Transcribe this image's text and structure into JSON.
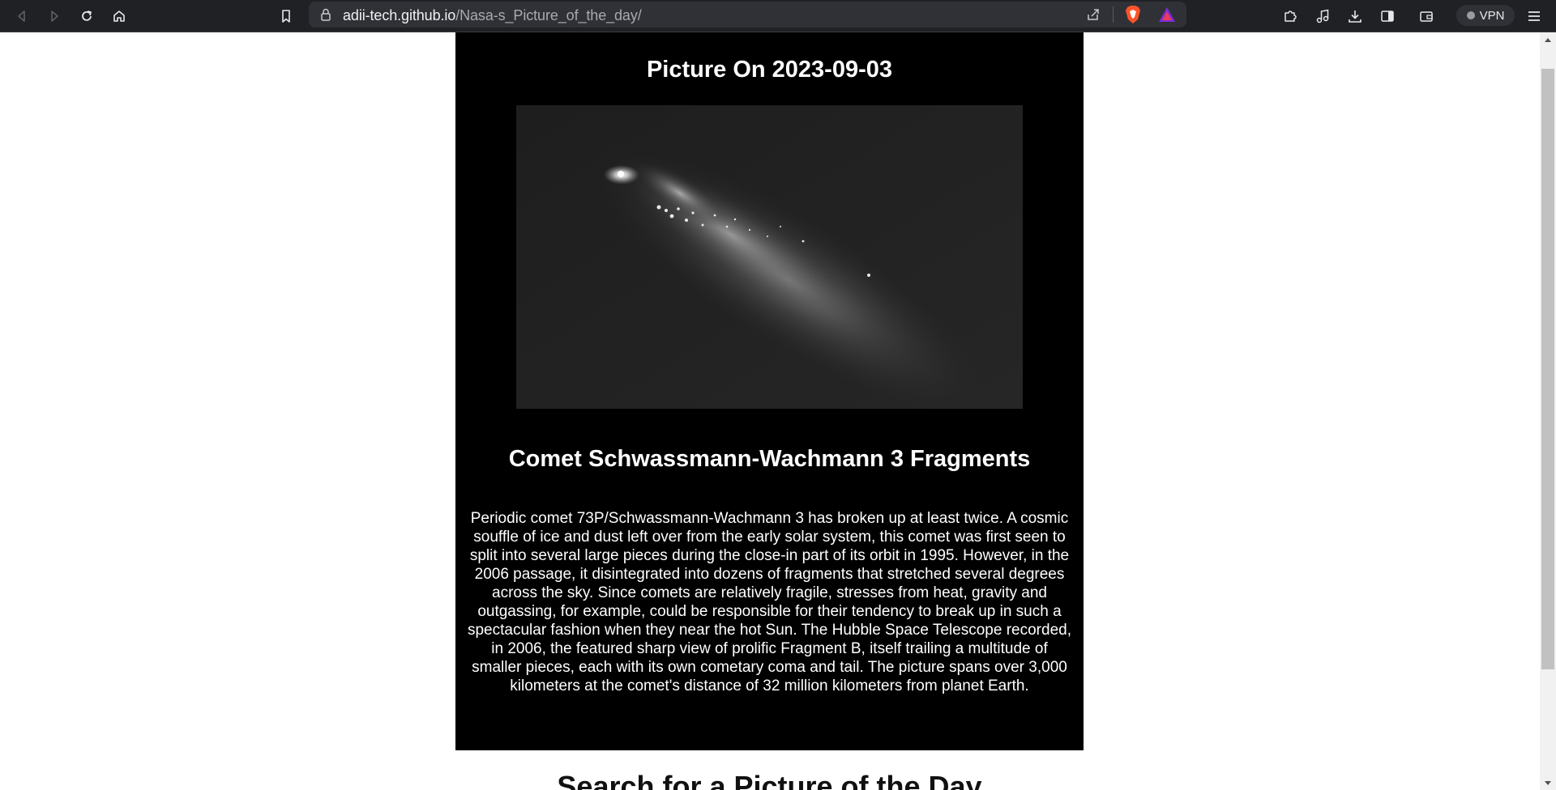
{
  "browser": {
    "url_host": "adii-tech.github.io",
    "url_path": "/Nasa-s_Picture_of_the_day/",
    "vpn_label": "VPN",
    "icons": [
      "back-icon",
      "forward-icon",
      "reload-icon",
      "home-icon",
      "bookmark-icon",
      "lock-icon",
      "share-icon",
      "brave-shields-icon",
      "brave-rewards-icon",
      "extensions-icon",
      "media-icon",
      "downloads-icon",
      "sidebar-icon",
      "wallet-icon",
      "menu-icon"
    ],
    "brave_color": "#fb542b"
  },
  "apod": {
    "date_heading": "Picture On 2023-09-03",
    "title": "Comet Schwassmann-Wachmann 3 Fragments",
    "explanation": "Periodic comet 73P/Schwassmann-Wachmann 3 has broken up at least twice. A cosmic souffle of ice and dust left over from the early solar system, this comet was first seen to split into several large pieces during the close-in part of its orbit in 1995. However, in the 2006 passage, it disintegrated into dozens of fragments that stretched several degrees across the sky. Since comets are relatively fragile, stresses from heat, gravity and outgassing, for example, could be responsible for their tendency to break up in such a spectacular fashion when they near the hot Sun. The Hubble Space Telescope recorded, in 2006, the featured sharp view of prolific Fragment B, itself trailing a multitude of smaller pieces, each with its own cometary coma and tail. The picture spans over 3,000 kilometers at the comet's distance of 32 million kilometers from planet Earth."
  },
  "search": {
    "heading": "Search for a Picture of the Day"
  }
}
